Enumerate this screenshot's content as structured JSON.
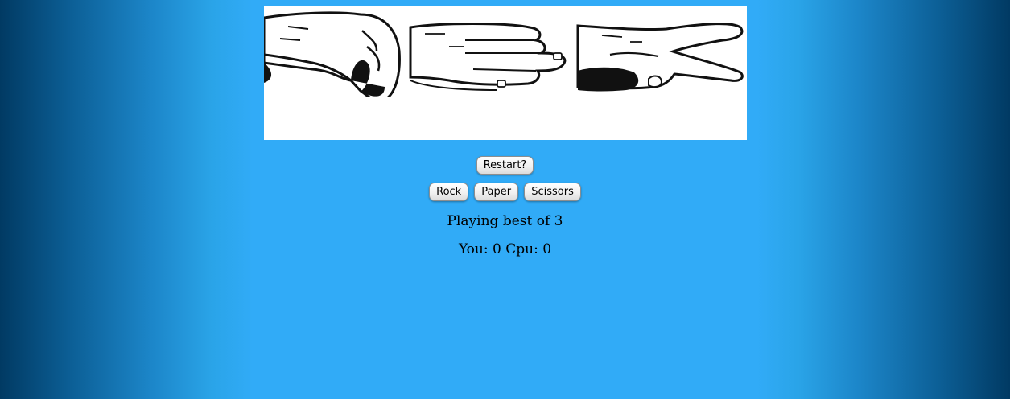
{
  "banner": {
    "words": [
      "ROCK",
      "PAPER",
      "SCISSORS"
    ]
  },
  "controls": {
    "restart_label": "Restart?",
    "choices": [
      "Rock",
      "Paper",
      "Scissors"
    ]
  },
  "status": {
    "best_of_text": "Playing best of 3",
    "you_label": "You:",
    "you_score": "0",
    "cpu_label": "Cpu:",
    "cpu_score": "0"
  },
  "colors": {
    "background_center": "#31abf7",
    "background_edge": "#013a63"
  },
  "icons": [
    "fist-hand-icon",
    "flat-hand-icon",
    "scissors-hand-icon"
  ]
}
